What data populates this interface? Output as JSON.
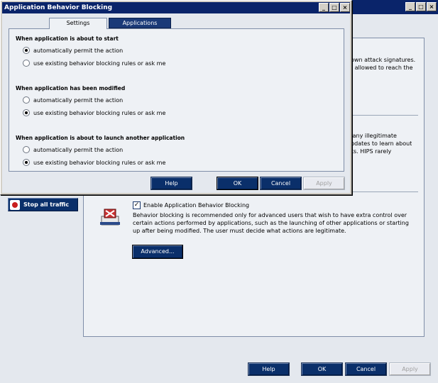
{
  "background_window": {
    "snippets": {
      "line1": "nown attack signatures.",
      "line2": "ot allowed to reach the",
      "line3": "g any illegitimate",
      "line4": "updates to learn about",
      "line5": "cks. HIPS rarely"
    },
    "stop_traffic_label": "Stop all traffic",
    "enable_behavior_blocking_label": "Enable Application Behavior Blocking",
    "enable_behavior_blocking_checked": true,
    "behavior_description": "Behavior blocking is recommended only for advanced users that wish to have extra control over certain actions performed by applications, such as the launching of other applications or starting up after being modified. The user must decide what actions are legitimate.",
    "advanced_button": "Advanced...",
    "buttons": {
      "help": "Help",
      "ok": "OK",
      "cancel": "Cancel",
      "apply": "Apply"
    }
  },
  "dialog": {
    "title": "Application Behavior Blocking",
    "tabs": [
      {
        "label": "Settings",
        "active": true
      },
      {
        "label": "Applications",
        "active": false
      }
    ],
    "sections": [
      {
        "title": "When application is about to start",
        "options": [
          {
            "label": "automatically permit the action",
            "selected": true
          },
          {
            "label": "use existing behavior blocking rules or ask me",
            "selected": false
          }
        ]
      },
      {
        "title": "When application has been modified",
        "options": [
          {
            "label": "automatically permit the action",
            "selected": false
          },
          {
            "label": "use existing behavior blocking rules or ask me",
            "selected": true
          }
        ]
      },
      {
        "title": "When application is about to launch another application",
        "options": [
          {
            "label": "automatically permit the action",
            "selected": false
          },
          {
            "label": "use existing behavior blocking rules or ask me",
            "selected": true
          }
        ]
      }
    ],
    "buttons": {
      "help": "Help",
      "ok": "OK",
      "cancel": "Cancel",
      "apply": "Apply"
    }
  },
  "colors": {
    "titlebar": "#0a246a",
    "button": "#0a2f6a",
    "panel": "#eef1f5"
  }
}
